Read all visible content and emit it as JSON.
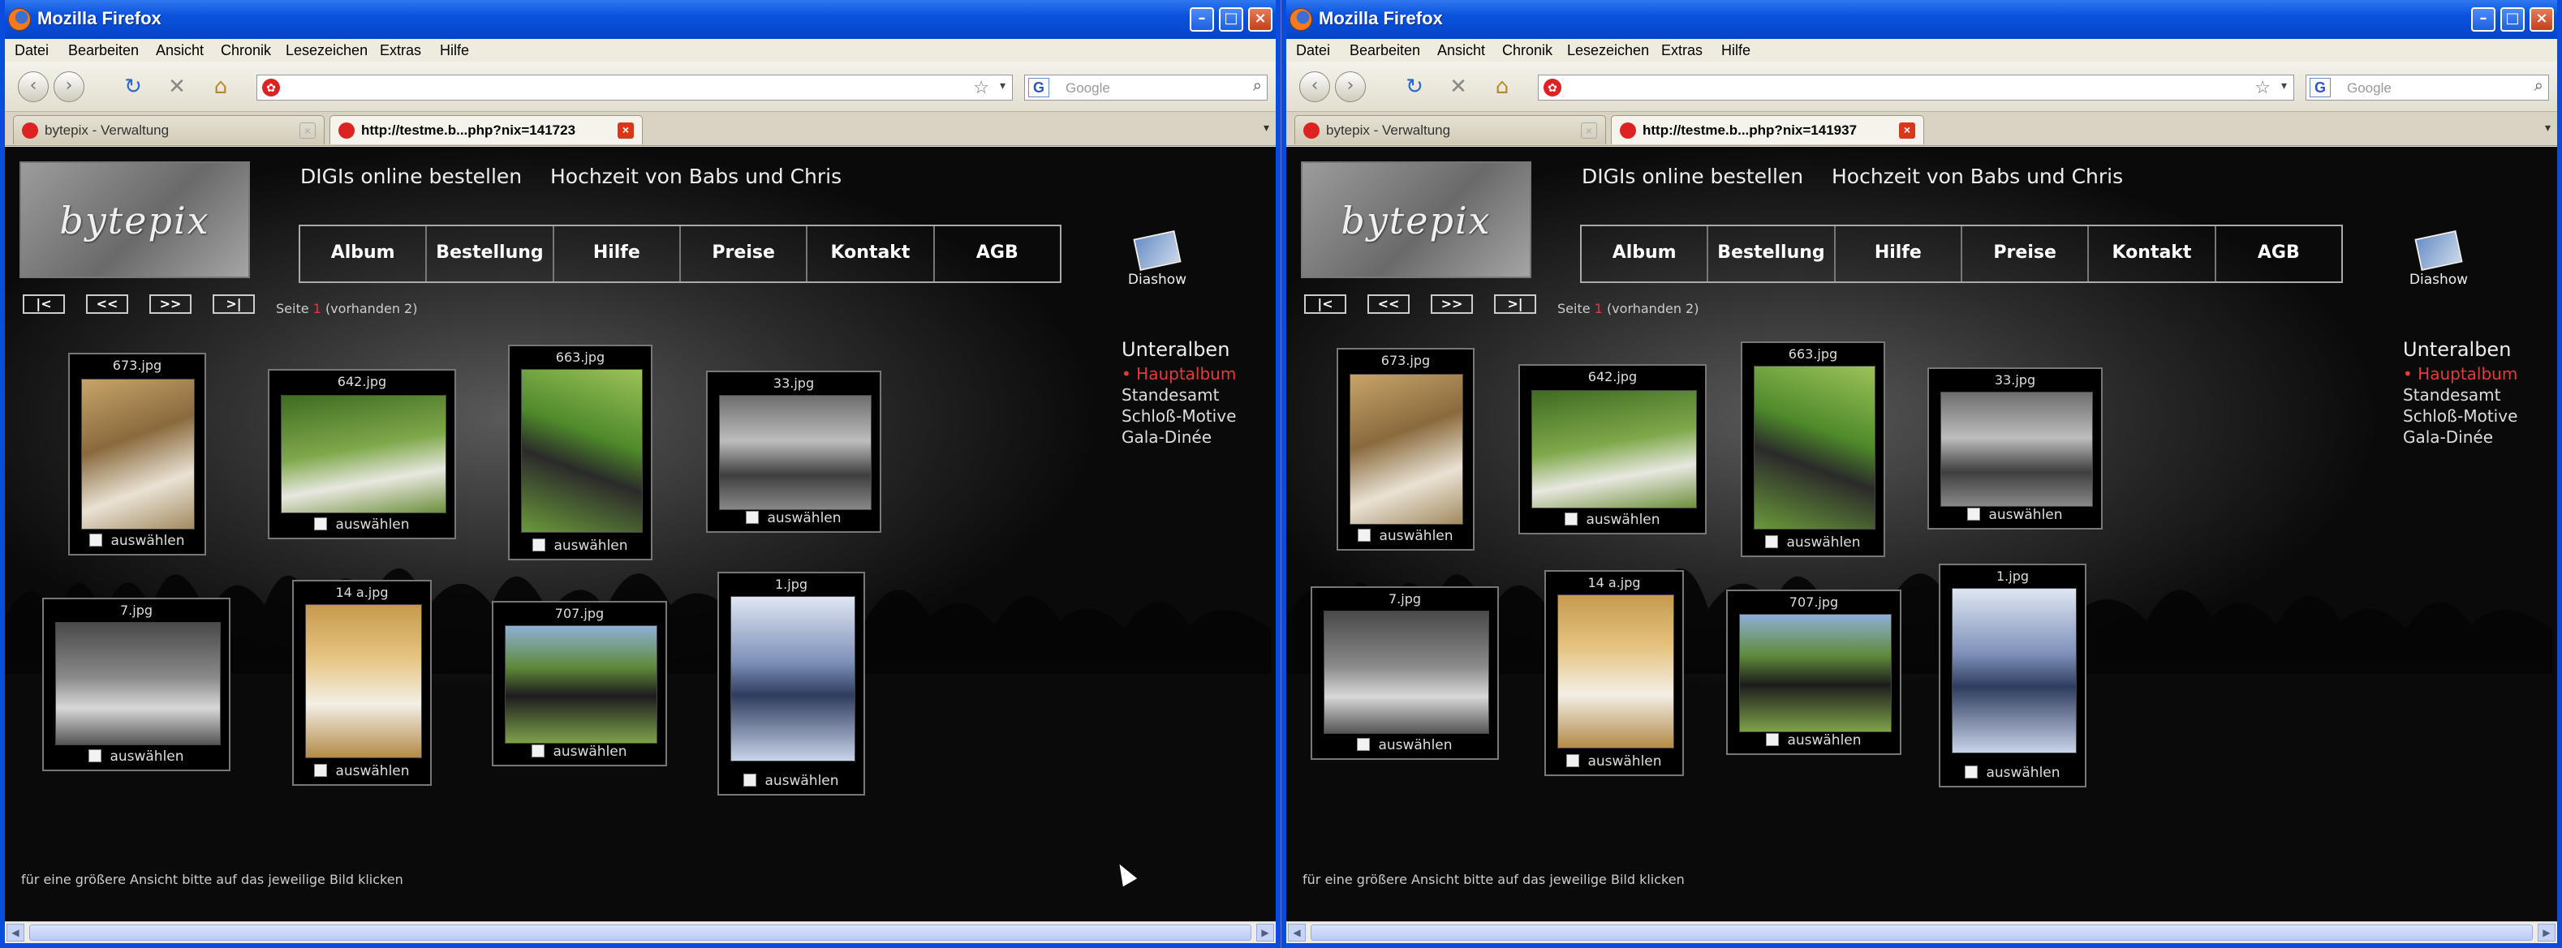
{
  "windows": [
    {
      "title": "Mozilla Firefox",
      "menu": [
        "Datei",
        "Bearbeiten",
        "Ansicht",
        "Chronik",
        "Lesezeichen",
        "Extras",
        "Hilfe"
      ],
      "search_placeholder": "Google",
      "tabs": [
        {
          "label": "bytepix - Verwaltung",
          "active": false
        },
        {
          "label": "http://testme.b...php?nix=141723",
          "active": true
        }
      ],
      "site": {
        "logo": "bytepix",
        "top_links": [
          "DIGIs online bestellen",
          "Hochzeit von Babs und Chris"
        ],
        "nav": [
          "Album",
          "Bestellung",
          "Hilfe",
          "Preise",
          "Kontakt",
          "AGB"
        ],
        "diashow": "Diashow",
        "pager": [
          "|<",
          "<<",
          ">>",
          ">|"
        ],
        "page_prefix": "Seite",
        "page_current": "1",
        "page_suffix": "(vorhanden 2)",
        "subalbums_title": "Unteralben",
        "subalbums": [
          {
            "label": "• Hauptalbum",
            "active": true
          },
          {
            "label": "Standesamt",
            "active": false
          },
          {
            "label": "Schloß-Motive",
            "active": false
          },
          {
            "label": "Gala-Dinée",
            "active": false
          }
        ],
        "select_label": "auswählen",
        "thumbnails": [
          "673.jpg",
          "642.jpg",
          "663.jpg",
          "33.jpg",
          "7.jpg",
          "14 a.jpg",
          "707.jpg",
          "1.jpg"
        ],
        "hint": "für eine größere Ansicht bitte auf das jeweilige Bild klicken"
      }
    },
    {
      "title": "Mozilla Firefox",
      "menu": [
        "Datei",
        "Bearbeiten",
        "Ansicht",
        "Chronik",
        "Lesezeichen",
        "Extras",
        "Hilfe"
      ],
      "search_placeholder": "Google",
      "tabs": [
        {
          "label": "bytepix - Verwaltung",
          "active": false
        },
        {
          "label": "http://testme.b...php?nix=141937",
          "active": true
        }
      ],
      "site": {
        "logo": "bytepix",
        "top_links": [
          "DIGIs online bestellen",
          "Hochzeit von Babs und Chris"
        ],
        "nav": [
          "Album",
          "Bestellung",
          "Hilfe",
          "Preise",
          "Kontakt",
          "AGB"
        ],
        "diashow": "Diashow",
        "pager": [
          "|<",
          "<<",
          ">>",
          ">|"
        ],
        "page_prefix": "Seite",
        "page_current": "1",
        "page_suffix": "(vorhanden 2)",
        "subalbums_title": "Unteralben",
        "subalbums": [
          {
            "label": "• Hauptalbum",
            "active": true
          },
          {
            "label": "Standesamt",
            "active": false
          },
          {
            "label": "Schloß-Motive",
            "active": false
          },
          {
            "label": "Gala-Dinée",
            "active": false
          }
        ],
        "select_label": "auswählen",
        "thumbnails": [
          "673.jpg",
          "642.jpg",
          "663.jpg",
          "33.jpg",
          "7.jpg",
          "14 a.jpg",
          "707.jpg",
          "1.jpg"
        ],
        "hint": "für eine größere Ansicht bitte auf das jeweilige Bild klicken"
      }
    }
  ],
  "colors": {
    "titlebar": "#0a52dd",
    "accent_red": "#e23b3b",
    "page_bg": "#0a0a0a"
  },
  "icons": [
    "firefox-logo-icon",
    "back-icon",
    "forward-icon",
    "reload-icon",
    "stop-icon",
    "home-icon",
    "bookmark-star-icon",
    "search-icon",
    "close-icon",
    "minimize-icon",
    "maximize-icon",
    "slideshow-icon"
  ]
}
